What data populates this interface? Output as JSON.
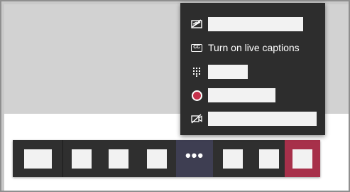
{
  "more_menu": {
    "items": [
      {
        "icon": "background-effects-icon",
        "label": ""
      },
      {
        "icon": "closed-captions-icon",
        "label": "Turn on live captions"
      },
      {
        "icon": "dial-pad-icon",
        "label": ""
      },
      {
        "icon": "record-icon",
        "label": ""
      },
      {
        "icon": "video-off-icon",
        "label": ""
      }
    ]
  },
  "control_bar": {
    "buttons": [
      {
        "name": "meeting-timer"
      },
      {
        "name": "camera-button"
      },
      {
        "name": "microphone-button"
      },
      {
        "name": "share-button"
      },
      {
        "name": "more-actions-button",
        "label": "•••"
      },
      {
        "name": "show-conversation-button"
      },
      {
        "name": "show-participants-button"
      },
      {
        "name": "hang-up-button"
      }
    ]
  },
  "colors": {
    "menu_background": "#2d2d2d",
    "control_bar": "#2f2f2f",
    "more_button_active": "#3e3e52",
    "hang_up": "#a7304a",
    "record_dot": "#c4314b",
    "video_area": "#d2d2d2"
  }
}
